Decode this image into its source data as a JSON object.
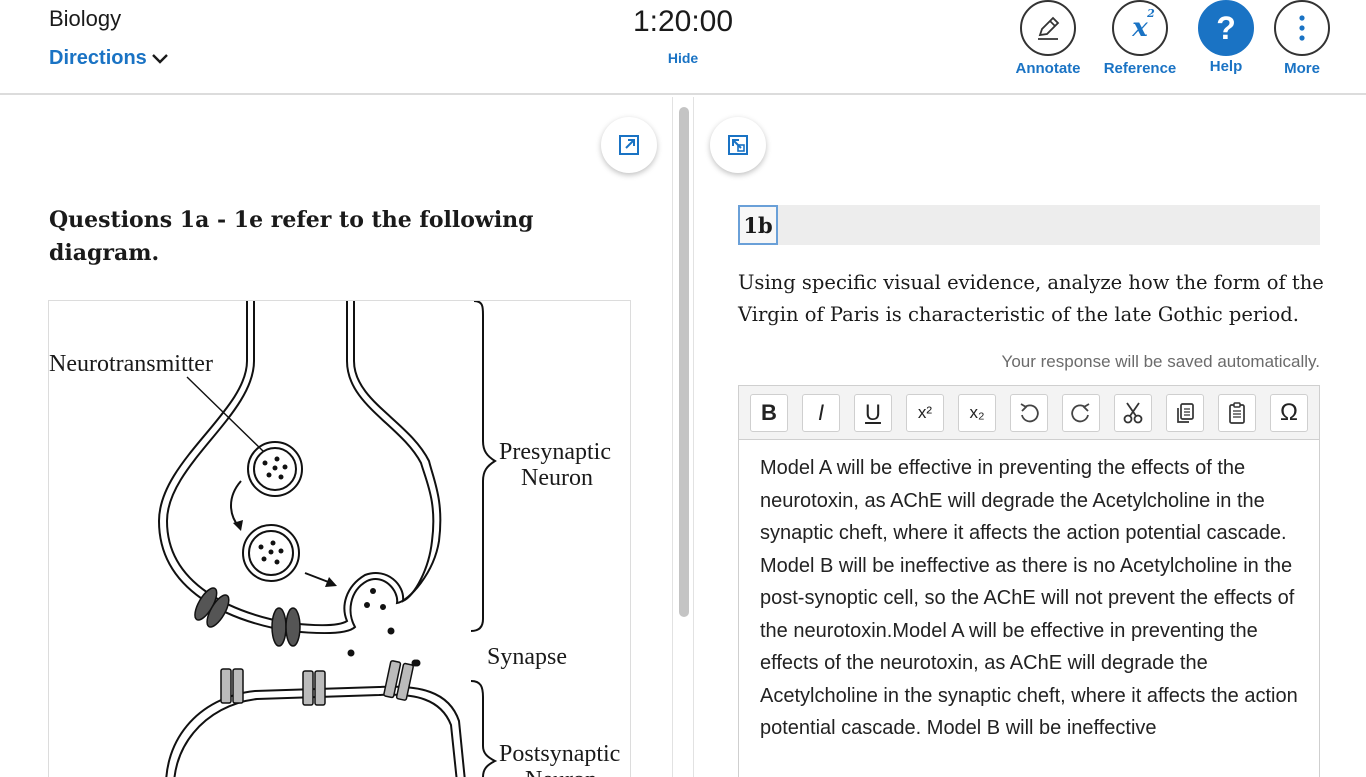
{
  "header": {
    "subject": "Biology",
    "directions_label": "Directions",
    "timer": "1:20:00",
    "hide_label": "Hide",
    "tools": [
      {
        "label": "Annotate",
        "icon": "pencil-icon"
      },
      {
        "label": "Reference",
        "icon": "x-squared-icon",
        "glyph": "x",
        "sup": "2"
      },
      {
        "label": "Help",
        "icon": "question-icon",
        "glyph": "?"
      },
      {
        "label": "More",
        "icon": "more-vertical-icon"
      }
    ]
  },
  "left": {
    "heading": "Questions 1a - 1e refer to the following diagram.",
    "diagram": {
      "labels": {
        "neurotransmitter": "Neurotransmitter",
        "presynaptic_line1": "Presynaptic",
        "presynaptic_line2": "Neuron",
        "synapse": "Synapse",
        "postsynaptic_line1": "Postsynaptic",
        "postsynaptic_line2": "Neuron"
      }
    }
  },
  "right": {
    "question_number": "1b",
    "prompt": "Using specific visual evidence, analyze how the form of the Virgin of Paris is characteristic of the late Gothic period.",
    "autosave_note": "Your response will be saved automatically.",
    "toolbar": [
      {
        "name": "bold-button",
        "glyph": "B"
      },
      {
        "name": "italic-button",
        "glyph": "I"
      },
      {
        "name": "underline-button",
        "glyph": "U"
      },
      {
        "name": "superscript-button",
        "glyph": "x²"
      },
      {
        "name": "subscript-button",
        "glyph": "x₂"
      },
      {
        "name": "undo-button",
        "glyph": "undo-icon"
      },
      {
        "name": "redo-button",
        "glyph": "redo-icon"
      },
      {
        "name": "cut-button",
        "glyph": "scissors-icon"
      },
      {
        "name": "copy-button",
        "glyph": "copy-icon"
      },
      {
        "name": "paste-button",
        "glyph": "clipboard-icon"
      },
      {
        "name": "special-character-button",
        "glyph": "Ω"
      }
    ],
    "response_text": "Model A will be effective in preventing the effects of the neurotoxin, as AChE will degrade the Acetylcholine in the synaptic cheft, where it affects the action potential cascade.  Model B will be ineffective as there is no Acetylcholine in the post-synoptic cell, so the AChE will not prevent the effects of the neurotoxin.Model A will be effective in preventing the effects of the neurotoxin, as AChE will degrade the Acetylcholine in the synaptic cheft, where it affects the action potential cascade.  Model B will be ineffective"
  },
  "colors": {
    "accent": "#1a73c4",
    "divider": "#dcdcdc",
    "scrollbar": "#c4c4c4"
  }
}
